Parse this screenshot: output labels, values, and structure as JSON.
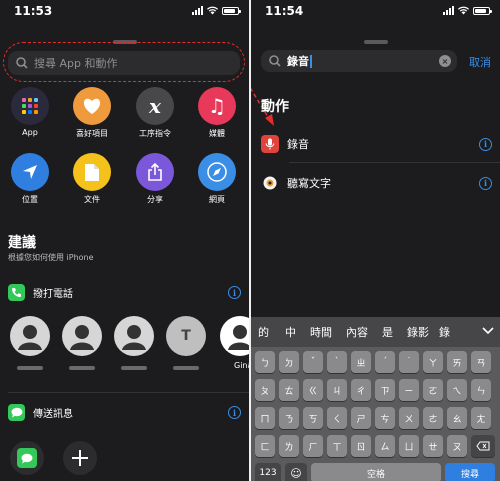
{
  "left": {
    "time": "11:53",
    "search_placeholder": "搜尋 App 和動作",
    "apps": [
      {
        "label": "App",
        "icon": "grid-icon",
        "color": "#2a2a3c"
      },
      {
        "label": "喜好項目",
        "icon": "heart-icon",
        "color": "#f09a3e"
      },
      {
        "label": "工序指令",
        "icon": "script-icon",
        "color": "#48484a"
      },
      {
        "label": "媒體",
        "icon": "music-icon",
        "color": "#e8395a"
      },
      {
        "label": "位置",
        "icon": "location-icon",
        "color": "#2f7fe0"
      },
      {
        "label": "文件",
        "icon": "document-icon",
        "color": "#f5c21b"
      },
      {
        "label": "分享",
        "icon": "share-icon",
        "color": "#7b57d9"
      },
      {
        "label": "網頁",
        "icon": "compass-icon",
        "color": "#3a8ee6"
      }
    ],
    "suggestions_title": "建議",
    "suggestions_sub": "根據您如何使用 iPhone",
    "call_label": "撥打電話",
    "contact_name": "Gina",
    "message_label": "傳送訊息"
  },
  "right": {
    "time": "11:54",
    "search_value": "錄音",
    "cancel_label": "取消",
    "actions_title": "動作",
    "actions": [
      {
        "label": "錄音",
        "icon": "microphone-icon"
      },
      {
        "label": "聽寫文字",
        "icon": "dictation-icon"
      }
    ],
    "candidates": [
      "的",
      "中",
      "時間",
      "內容",
      "是",
      "錄影",
      "錄"
    ],
    "rows": [
      [
        "ㄅ",
        "ㄉ",
        "ˇ",
        "ˋ",
        "ㄓ",
        "ˊ",
        "˙",
        "ㄚ",
        "ㄞ",
        "ㄢ"
      ],
      [
        "ㄆ",
        "ㄊ",
        "ㄍ",
        "ㄐ",
        "ㄔ",
        "ㄗ",
        "ㄧ",
        "ㄛ",
        "ㄟ",
        "ㄣ"
      ],
      [
        "ㄇ",
        "ㄋ",
        "ㄎ",
        "ㄑ",
        "ㄕ",
        "ㄘ",
        "ㄨ",
        "ㄜ",
        "ㄠ",
        "ㄤ"
      ],
      [
        "ㄈ",
        "ㄌ",
        "ㄏ",
        "ㄒ",
        "ㄖ",
        "ㄙ",
        "ㄩ",
        "ㄝ",
        "ㄡ"
      ]
    ],
    "key_123": "123",
    "space_label": "空格",
    "search_key_label": "搜尋"
  }
}
